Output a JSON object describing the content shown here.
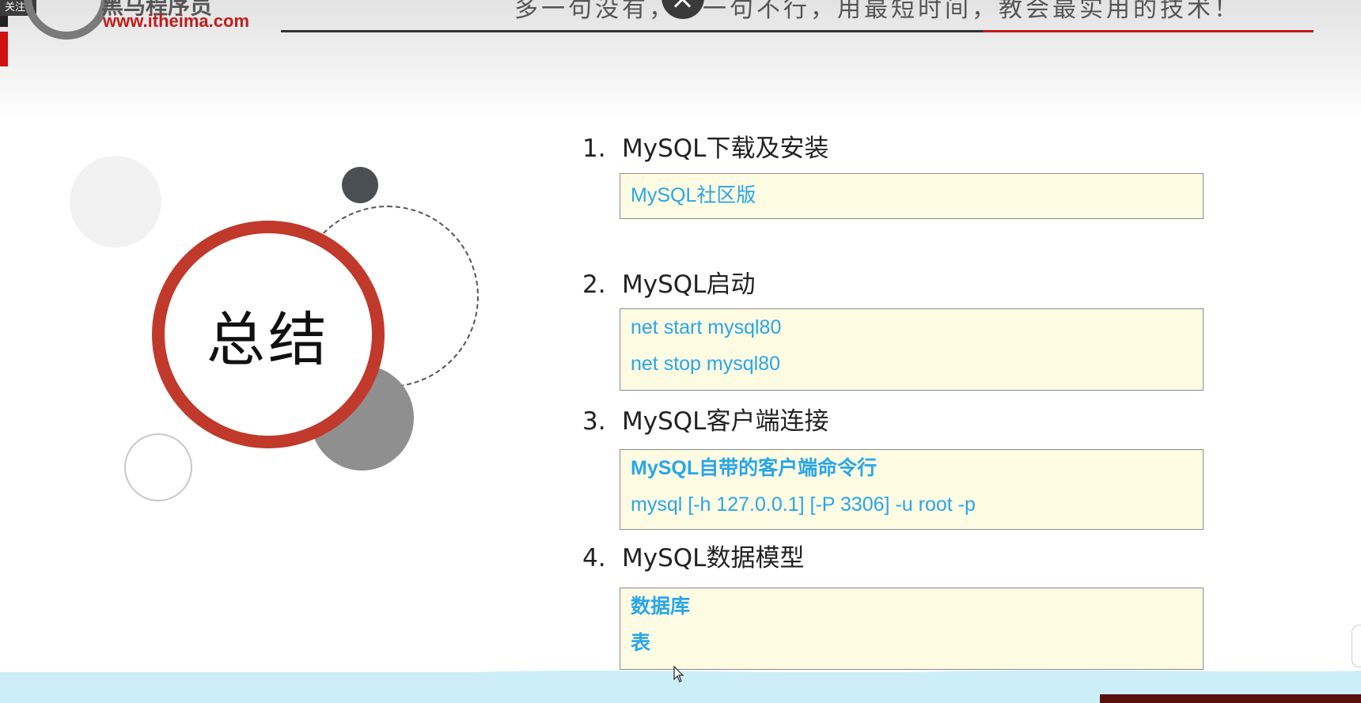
{
  "header": {
    "follow_badge": "关注",
    "logo_title": "黑马程序员",
    "logo_url": "www.itheima.com",
    "slogan": "多一句没有，少一句不行，用最短时间，教会最实用的技术！"
  },
  "summary": {
    "title": "总结"
  },
  "sections": [
    {
      "number": "1.",
      "title": "MySQL下载及安装",
      "lines": [
        "MySQL社区版"
      ]
    },
    {
      "number": "2.",
      "title": "MySQL启动",
      "lines": [
        "net start mysql80",
        "net stop mysql80"
      ]
    },
    {
      "number": "3.",
      "title": "MySQL客户端连接",
      "lines": [
        "MySQL自带的客户端命令行",
        "mysql  [-h 127.0.0.1]  [-P 3306]  -u root -p"
      ]
    },
    {
      "number": "4.",
      "title": "MySQL数据模型",
      "lines": [
        "数据库",
        "表"
      ]
    }
  ],
  "colors": {
    "accent_red": "#c0392b",
    "box_text_blue": "#29a6e8",
    "box_background": "#fefbe3"
  }
}
